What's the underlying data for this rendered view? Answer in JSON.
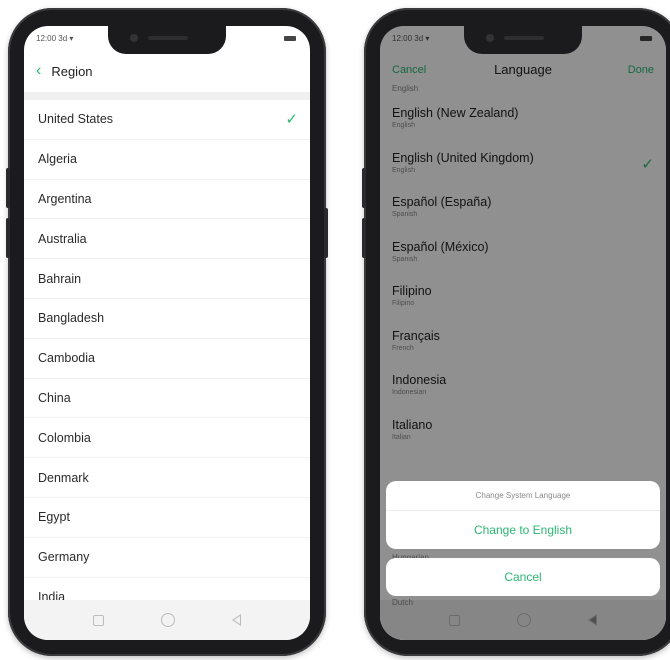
{
  "left_screen": {
    "status_time": "12:00 3d ▾",
    "header_title": "Region",
    "selected_index": 0,
    "regions": [
      "United States",
      "Algeria",
      "Argentina",
      "Australia",
      "Bahrain",
      "Bangladesh",
      "Cambodia",
      "China",
      "Colombia",
      "Denmark",
      "Egypt",
      "Germany",
      "India"
    ]
  },
  "right_screen": {
    "status_time": "12:00 3d ▾",
    "cancel_label": "Cancel",
    "header_title": "Language",
    "done_label": "Done",
    "partial_top": "English",
    "languages": [
      {
        "name": "English (New Zealand)",
        "sub": "English"
      },
      {
        "name": "English (United Kingdom)",
        "sub": "English"
      },
      {
        "name": "Español (España)",
        "sub": "Spanish"
      },
      {
        "name": "Español (México)",
        "sub": "Spanish"
      },
      {
        "name": "Filipino",
        "sub": "Filipino"
      },
      {
        "name": "Français",
        "sub": "French"
      },
      {
        "name": "Indonesia",
        "sub": "Indonesian"
      },
      {
        "name": "Italiano",
        "sub": "Italian"
      }
    ],
    "selected_index": 1,
    "under_sheet_1": "Hungarian",
    "under_sheet_2": "Dutch",
    "dialog_message": "Change System Language",
    "dialog_action": "Change to English",
    "dialog_cancel": "Cancel"
  },
  "colors": {
    "accent": "#2bb673",
    "text": "#222222",
    "subtext": "#8a8a8a"
  },
  "icons": {
    "back": "chevron-left-icon",
    "check": "checkmark-icon",
    "nav": [
      "recent-apps-icon",
      "home-icon",
      "back-triangle-icon"
    ]
  }
}
